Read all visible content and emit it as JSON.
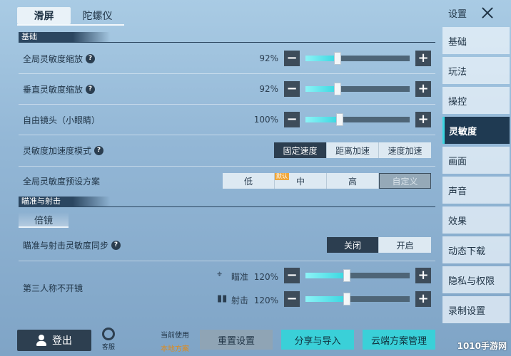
{
  "top_tabs": [
    {
      "label": "滑屏",
      "active": true
    },
    {
      "label": "陀螺仪",
      "active": false
    }
  ],
  "sidebar": {
    "title": "设置",
    "items": [
      {
        "label": "基础",
        "active": false
      },
      {
        "label": "玩法",
        "active": false
      },
      {
        "label": "操控",
        "active": false
      },
      {
        "label": "灵敏度",
        "active": true
      },
      {
        "label": "画面",
        "active": false
      },
      {
        "label": "声音",
        "active": false
      },
      {
        "label": "效果",
        "active": false
      },
      {
        "label": "动态下载",
        "active": false
      },
      {
        "label": "隐私与权限",
        "active": false
      },
      {
        "label": "录制设置",
        "active": false
      }
    ]
  },
  "sections": {
    "basic": "基础",
    "aim": "瞄准与射击",
    "scope": "倍镜"
  },
  "rows": {
    "global_scale": {
      "label": "全局灵敏度缩放",
      "value": "92%",
      "level": 0.31
    },
    "vertical_scale": {
      "label": "垂直灵敏度缩放",
      "value": "92%",
      "level": 0.31
    },
    "free_lens": {
      "label": "自由镜头（小眼睛）",
      "value": "100%",
      "level": 0.33
    },
    "accel_mode": {
      "label": "灵敏度加速度模式",
      "options": [
        "固定速度",
        "距离加速",
        "速度加速"
      ],
      "selected": 0
    },
    "preset": {
      "label": "全局灵敏度预设方案",
      "options": [
        "低",
        "中",
        "高",
        "自定义"
      ],
      "selected": 3,
      "badge": "默认"
    },
    "sync": {
      "label": "瞄准与射击灵敏度同步",
      "options": [
        "关闭",
        "开启"
      ],
      "selected": 0
    },
    "third_person": {
      "label": "第三人称不开镜",
      "aim": {
        "label": "瞄准",
        "value": "120%",
        "level": 0.4
      },
      "fire": {
        "label": "射击",
        "value": "120%",
        "level": 0.4
      }
    }
  },
  "bottom": {
    "login": "登出",
    "service": "客服",
    "current_label": "当前使用",
    "current_scheme": "本地方案",
    "reset": "重置设置",
    "share": "分享与导入",
    "cloud": "云端方案管理"
  },
  "watermark": "1010手游网",
  "icons": {
    "minus": "−",
    "plus": "+",
    "help": "?"
  }
}
